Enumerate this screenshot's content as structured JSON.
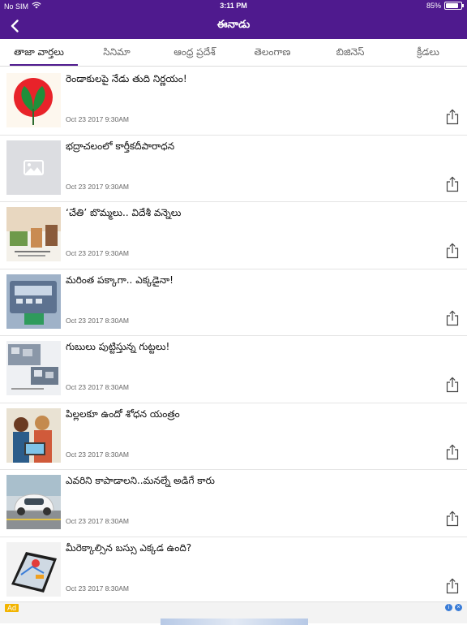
{
  "statusbar": {
    "carrier": "No SIM",
    "time": "3:11 PM",
    "battery": "85%",
    "battery_level": 0.85
  },
  "navbar": {
    "title": "ఈనాడు"
  },
  "tabs": [
    {
      "label": "తాజా వార్తలు"
    },
    {
      "label": "సినిమా"
    },
    {
      "label": "ఆంధ్ర ప్రదేశ్"
    },
    {
      "label": "తెలంగాణ"
    },
    {
      "label": "బిజినెస్"
    },
    {
      "label": "క్రీడలు"
    }
  ],
  "articles": [
    {
      "title": "రెండాకులపై నేడు తుది నిర్ణయం!",
      "date": "Oct 23 2017  9:30AM",
      "thumb": "leaves-symbol"
    },
    {
      "title": "భద్రాచలంలో కార్తీకదీపారాధన",
      "date": "Oct 23 2017  9:30AM",
      "thumb": "placeholder"
    },
    {
      "title": "‘చేతి’ బొమ్మలు.. విదేశీ వన్నెలు",
      "date": "Oct 23 2017  9:30AM",
      "thumb": "craft"
    },
    {
      "title": "మరింత పక్కాగా.. ఎక్కడైనా!",
      "date": "Oct 23 2017  8:30AM",
      "thumb": "device"
    },
    {
      "title": "గుబులు పుట్టిస్తున్న గుట్టలు!",
      "date": "Oct 23 2017  8:30AM",
      "thumb": "hills"
    },
    {
      "title": "పిల్లలకూ ఉందో శోధన యంత్రం",
      "date": "Oct 23 2017  8:30AM",
      "thumb": "kids"
    },
    {
      "title": "ఎవరిని కాపాడాలని..మనల్నే అడిగే కారు",
      "date": "Oct 23 2017  8:30AM",
      "thumb": "car"
    },
    {
      "title": "మీరెక్కాల్సిన బస్సు ఎక్కడ ఉంది?",
      "date": "Oct 23 2017  8:30AM",
      "thumb": "phone-map"
    }
  ],
  "ad": {
    "badge": "Ad",
    "info_icon": "info-icon",
    "close_icon": "close-icon"
  },
  "colors": {
    "brand": "#4f1a8e",
    "ad_badge": "#f2b400"
  }
}
